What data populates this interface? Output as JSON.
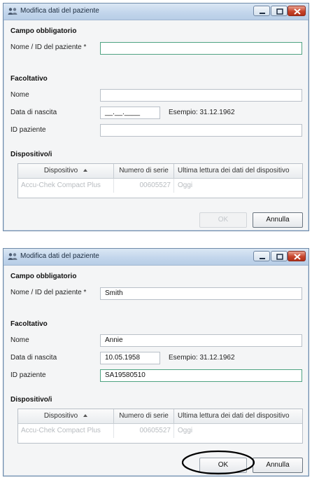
{
  "window1": {
    "title": "Modifica dati del paziente",
    "required_section": "Campo obbligatorio",
    "name_id_label": "Nome / ID del paziente *",
    "name_id_value": "",
    "optional_section": "Facoltativo",
    "first_name_label": "Nome",
    "first_name_value": "",
    "dob_label": "Data di nascita",
    "dob_value": "__.__.____",
    "dob_hint": "Esempio: 31.12.1962",
    "patient_id_label": "ID paziente",
    "patient_id_value": "",
    "devices_section": "Dispositivo/i",
    "columns": [
      "Dispositivo",
      "Numero di serie",
      "Ultima lettura dei dati del dispositivo"
    ],
    "row": [
      "Accu-Chek Compact Plus",
      "00605527",
      "Oggi"
    ],
    "ok_label": "OK",
    "cancel_label": "Annulla"
  },
  "window2": {
    "title": "Modifica dati del paziente",
    "required_section": "Campo obbligatorio",
    "name_id_label": "Nome / ID del paziente *",
    "name_id_value": "Smith",
    "optional_section": "Facoltativo",
    "first_name_label": "Nome",
    "first_name_value": "Annie",
    "dob_label": "Data di nascita",
    "dob_value": "10.05.1958",
    "dob_hint": "Esempio: 31.12.1962",
    "patient_id_label": "ID paziente",
    "patient_id_value": "SA19580510",
    "devices_section": "Dispositivo/i",
    "columns": [
      "Dispositivo",
      "Numero di serie",
      "Ultima lettura dei dati del dispositivo"
    ],
    "row": [
      "Accu-Chek Compact Plus",
      "00605527",
      "Oggi"
    ],
    "ok_label": "OK",
    "cancel_label": "Annulla"
  },
  "colors": {
    "titlebar": "#c3d6ec",
    "focus_border": "#4fa382",
    "close_button": "#c7452c",
    "highlight_ellipse": "#000000"
  },
  "icons": [
    "users-icon",
    "minimize-icon",
    "maximize-icon",
    "close-icon",
    "sort-ascending-icon"
  ]
}
